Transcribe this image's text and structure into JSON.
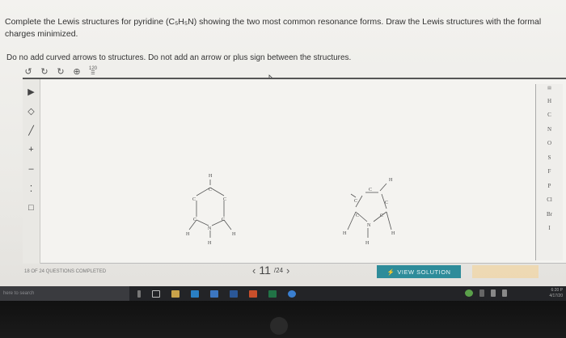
{
  "question": {
    "text": "Complete the Lewis structures for pyridine (C₅H₅N) showing the two most common resonance forms. Draw the Lewis structures with the formal charges minimized."
  },
  "instruction": "Do no add curved arrows to structures. Do not add an arrow or plus sign between the structures.",
  "top_toolbar": [
    {
      "name": "undo-icon",
      "glyph": "↺"
    },
    {
      "name": "redo-icon",
      "glyph": "↻"
    },
    {
      "name": "clear-icon",
      "glyph": "↻"
    },
    {
      "name": "zoom-icon",
      "glyph": "⊕"
    }
  ],
  "zoom_label": "120",
  "left_tools": [
    {
      "name": "select-tool",
      "glyph": "▶"
    },
    {
      "name": "eraser-tool",
      "glyph": "◇"
    },
    {
      "name": "bond-tool",
      "glyph": "╱"
    },
    {
      "name": "positive-charge-tool",
      "glyph": "+"
    },
    {
      "name": "negative-charge-tool",
      "glyph": "–"
    },
    {
      "name": "lone-pair-tool",
      "glyph": "⁚"
    },
    {
      "name": "box-tool",
      "glyph": "□"
    }
  ],
  "elements": [
    "H",
    "C",
    "N",
    "O",
    "S",
    "F",
    "P",
    "Cl",
    "Br",
    "I"
  ],
  "molecule": {
    "atoms": {
      "C": "C",
      "N": "N",
      "H": "H"
    }
  },
  "status": "18 OF 24 QUESTIONS COMPLETED",
  "pager": {
    "prev": "‹",
    "current": "11",
    "total": "/24",
    "next": "›"
  },
  "view_solution": "VIEW SOLUTION",
  "taskbar": {
    "search_placeholder": "here to search",
    "time": "6:20 P",
    "date": "4/17/20"
  },
  "colors": {
    "accent": "#2e8c9a",
    "taskbar": "#232427"
  }
}
